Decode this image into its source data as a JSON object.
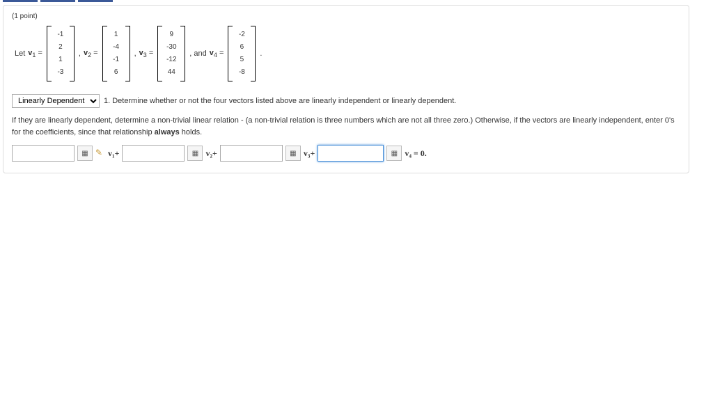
{
  "points_label": "(1 point)",
  "let_label": "Let ",
  "v_symbol": "v",
  "eq_sign": " = ",
  "sep": " , ",
  "and_label": " , and ",
  "period": " .",
  "vectors": {
    "v1": [
      "-1",
      "2",
      "1",
      "-3"
    ],
    "v2": [
      "1",
      "-4",
      "-1",
      "6"
    ],
    "v3": [
      "9",
      "-30",
      "-12",
      "44"
    ],
    "v4": [
      "-2",
      "6",
      "5",
      "-8"
    ]
  },
  "dropdown": {
    "selected": "Linearly Dependent"
  },
  "question1": "1. Determine whether or not the four vectors listed above are linearly independent or linearly dependent.",
  "explain_text": "If they are linearly dependent, determine a non-trivial linear relation - (a non-trivial relation is three numbers which are not all three zero.) Otherwise, if the vectors are linearly independent, enter 0's for the coefficients, since that relationship ",
  "always": "always",
  "holds": " holds.",
  "coeff_labels": {
    "v1_plus": "v₁+",
    "v2_plus": "v₂+",
    "v3_plus": "v₃+",
    "v4_eq": "v₄ = 0."
  },
  "coeff_values": {
    "c1": "",
    "c2": "",
    "c3": "",
    "c4": ""
  }
}
